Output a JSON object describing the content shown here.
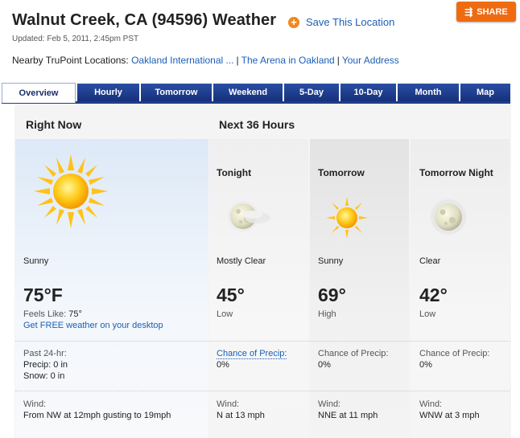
{
  "header": {
    "title": "Walnut Creek, CA (94596) Weather",
    "save_label": "Save This Location",
    "share_label": "SHARE",
    "updated": "Updated: Feb 5, 2011, 2:45pm PST",
    "nearby_label": "Nearby TruPoint Locations:",
    "nearby_links": [
      "Oakland International ...",
      "The Arena in Oakland",
      "Your Address"
    ]
  },
  "tabs": [
    "Overview",
    "Hourly",
    "Tomorrow",
    "Weekend",
    "5-Day",
    "10-Day",
    "Month",
    "Map"
  ],
  "sections": {
    "right_now": "Right Now",
    "next36": "Next 36 Hours"
  },
  "now": {
    "icon": "sun-icon",
    "condition": "Sunny",
    "temp": "75°F",
    "feels_label": "Feels Like:",
    "feels_value": "75°",
    "desktop_link": "Get FREE weather on your desktop",
    "past24": "Past 24-hr:",
    "precip": "Precip: 0 in",
    "snow": "Snow: 0 in",
    "wind_label": "Wind:",
    "wind_value": "From NW at 12mph gusting to 19mph"
  },
  "forecast": [
    {
      "period": "Tonight",
      "icon": "moon-partly-clear-icon",
      "condition": "Mostly Clear",
      "temp": "45°",
      "hl": "Low",
      "precip_label": "Chance of Precip:",
      "precip": "0%",
      "wind_label": "Wind:",
      "wind": "N at 13 mph"
    },
    {
      "period": "Tomorrow",
      "icon": "sun-icon",
      "condition": "Sunny",
      "temp": "69°",
      "hl": "High",
      "precip_label": "Chance of Precip:",
      "precip": "0%",
      "wind_label": "Wind:",
      "wind": "NNE at 11 mph"
    },
    {
      "period": "Tomorrow Night",
      "icon": "moon-icon",
      "condition": "Clear",
      "temp": "42°",
      "hl": "Low",
      "precip_label": "Chance of Precip:",
      "precip": "0%",
      "wind_label": "Wind:",
      "wind": "WNW at 3 mph"
    }
  ],
  "colors": {
    "tab_bg": "#1f3e86",
    "link": "#1b5fb7",
    "share": "#ef6b12",
    "accent": "#f2871f"
  }
}
